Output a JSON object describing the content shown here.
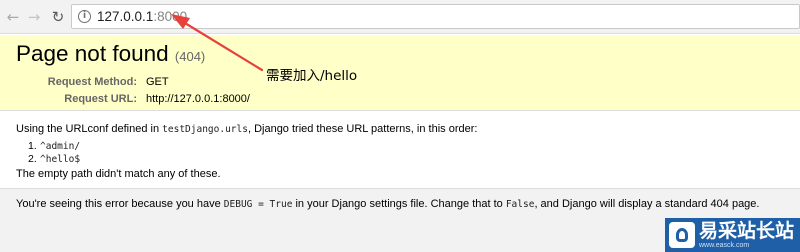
{
  "browser": {
    "back_icon": "arrow-left-icon",
    "forward_icon": "arrow-right-icon",
    "reload_icon": "reload-icon",
    "info_icon": "info-circle-icon",
    "url_host": "127.0.0.1",
    "url_port": ":8000"
  },
  "summary": {
    "title": "Page not found",
    "status": "(404)",
    "request_method_label": "Request Method:",
    "request_method_value": "GET",
    "request_url_label": "Request URL:",
    "request_url_value": "http://127.0.0.1:8000/",
    "background_color": "#ffffc8"
  },
  "annotation": {
    "text": "需要加入/hello",
    "arrow_color": "#e8403a"
  },
  "info": {
    "intro_before": "Using the URLconf defined in ",
    "urlconf": "testDjango.urls",
    "intro_after": ", Django tried these URL patterns, in this order:",
    "patterns": [
      {
        "num": "1.",
        "pattern": "^admin/"
      },
      {
        "num": "2.",
        "pattern": "^hello$"
      }
    ],
    "empty_message": "The empty path didn't match any of these."
  },
  "explanation": {
    "text_1": "You're seeing this error because you have ",
    "debug_setting": "DEBUG = True",
    "text_2": " in your Django settings file. Change that to ",
    "false_value": "False",
    "text_3": ", and Django will display a standard 404 page."
  },
  "watermark": {
    "text": "易采站长站",
    "subtext": "www.easck.com"
  }
}
